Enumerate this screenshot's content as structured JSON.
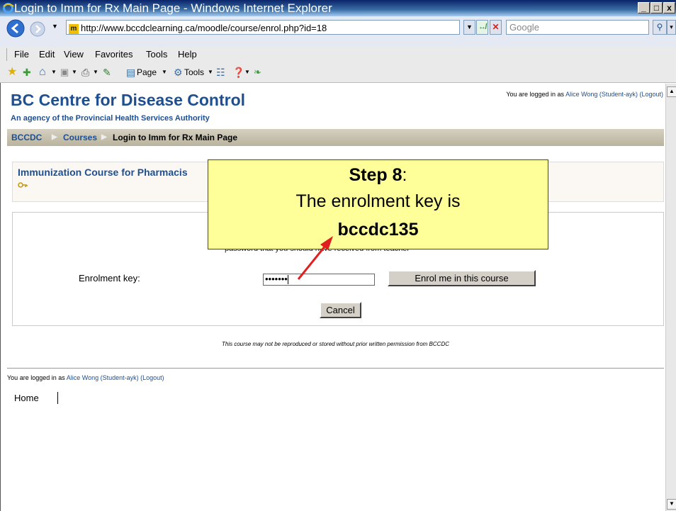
{
  "window": {
    "title": "Login to Imm for Rx Main Page - Windows Internet Explorer",
    "minimize": "_",
    "maximize": "□",
    "close": "x"
  },
  "address_bar": {
    "url": "http://www.bccdclearning.ca/moodle/course/enrol.php?id=18",
    "search_placeholder": "Google"
  },
  "menu": [
    "File",
    "Edit",
    "View",
    "Favorites",
    "Tools",
    "Help"
  ],
  "command_bar": {
    "page_label": "Page",
    "tools_label": "Tools"
  },
  "site": {
    "title": "BC Centre for Disease Control",
    "subtitle": "An agency of the Provincial Health Services Authority",
    "login_prefix": "You are logged in as ",
    "user_name": "Alice Wong (Student-ayk)",
    "logout": "(Logout)"
  },
  "breadcrumb": [
    "BCCDC",
    "Courses",
    "Login to Imm for Rx Main Page"
  ],
  "course": {
    "title": "Immunization Course for Pharmacis"
  },
  "enrol_form": {
    "note": "password that you should have received from teacher",
    "key_label": "Enrolment key:",
    "key_value": "•••••••",
    "enrol_button": "Enrol me in this course",
    "cancel_button": "Cancel"
  },
  "footer": {
    "copyright": "This course may not be reproduced or stored without prior written permission from BCCDC",
    "home": "Home"
  },
  "callout": {
    "step": "Step 8",
    "step_suffix": ":",
    "line2": "The enrolment key is",
    "key": "bccdc135"
  },
  "colors": {
    "brand": "#1d4f91",
    "callout_bg": "#ffff99",
    "arrow": "#e02020"
  }
}
